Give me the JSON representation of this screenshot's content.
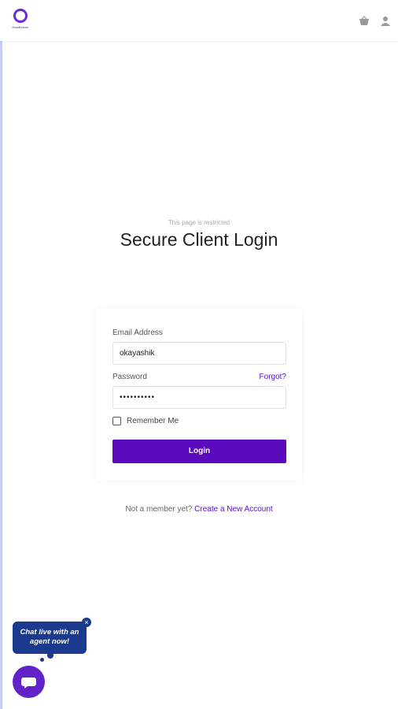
{
  "header": {
    "logo_text": "HostBeever",
    "basket_icon": "basket-icon",
    "user_icon": "user-icon"
  },
  "page": {
    "restricted_notice": "This page is restricted",
    "title": "Secure Client Login"
  },
  "login_form": {
    "email_label": "Email Address",
    "email_value": "okayashik",
    "password_label": "Password",
    "password_value": "••••••••••",
    "forgot_label": "Forgot?",
    "remember_label": "Remember Me",
    "login_button": "Login"
  },
  "signup": {
    "prompt": "Not a member yet?",
    "link": "Create a New Account"
  },
  "chat": {
    "bubble_text": "Chat live with an agent now!",
    "close_glyph": "×"
  },
  "colors": {
    "accent": "#5b0bbd",
    "chat_blue": "#1a3a8f"
  }
}
